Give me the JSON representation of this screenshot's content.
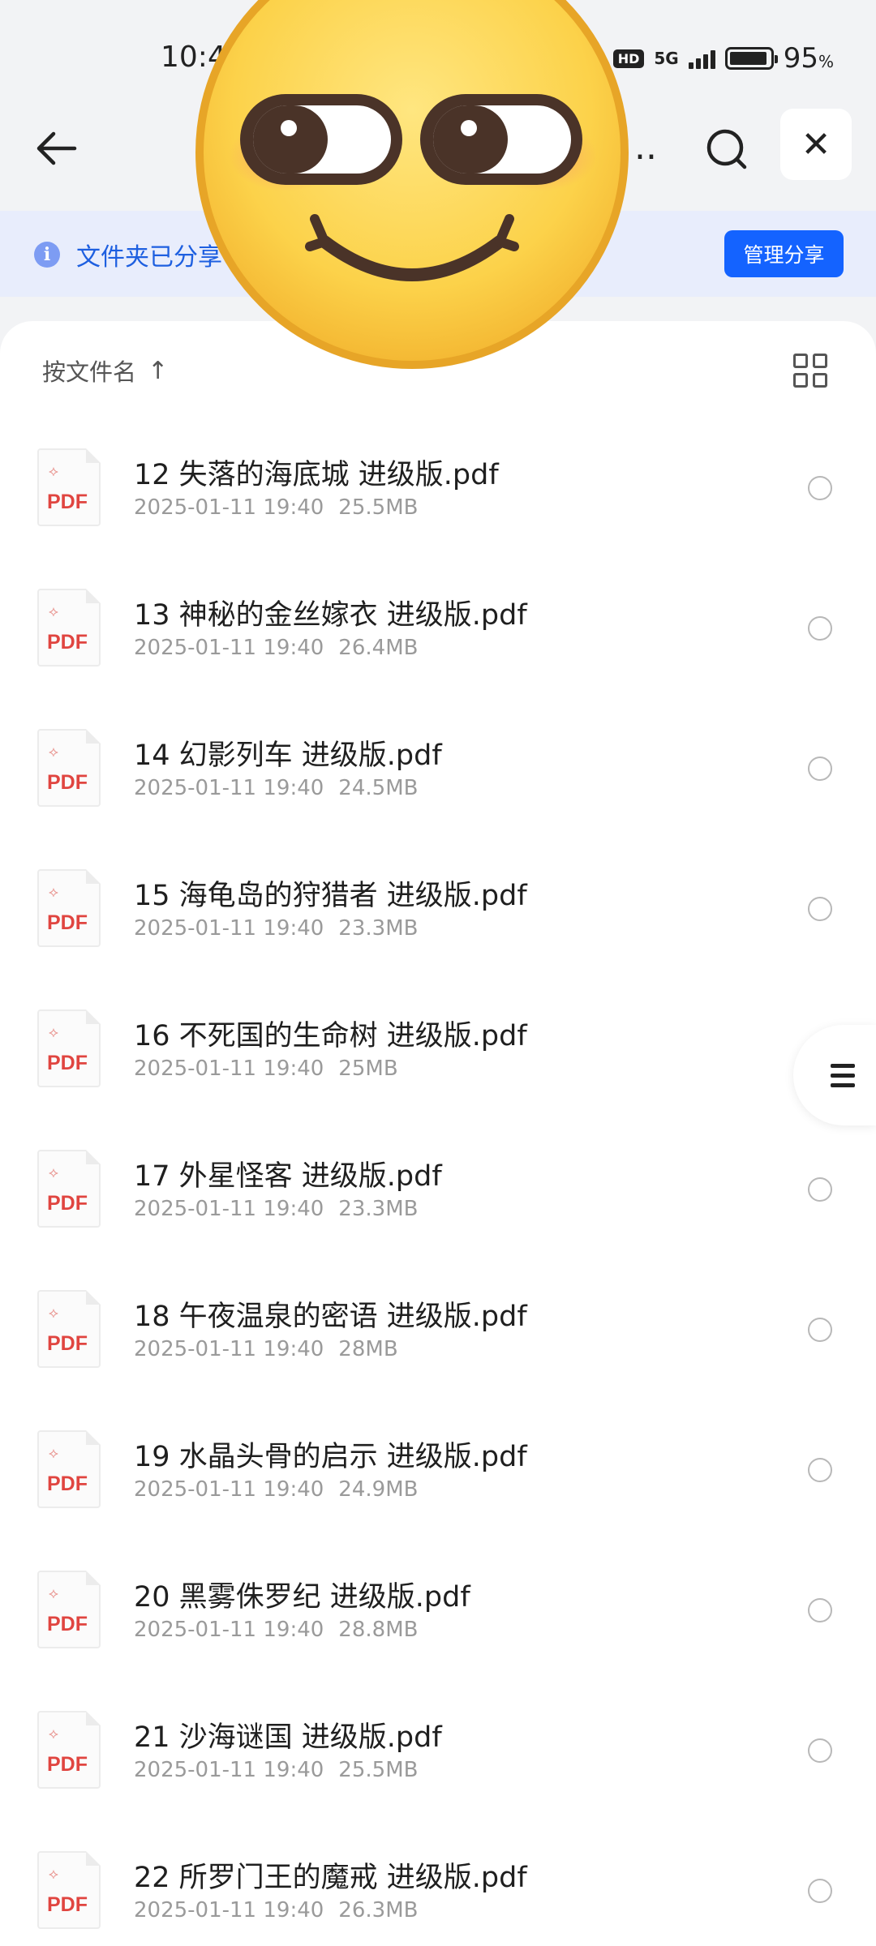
{
  "status_bar": {
    "time": "10:4",
    "battery_text": "95",
    "battery_pct": "%",
    "net_type": "5G",
    "hd_badge": "HD"
  },
  "header": {
    "title": "..",
    "back_icon": "arrow-left-icon",
    "search_icon": "search-icon",
    "close_icon": "close-icon",
    "close_glyph": "✕"
  },
  "share_banner": {
    "info_glyph": "i",
    "text": "文件夹已分享",
    "button_label": "管理分享"
  },
  "toolbar": {
    "sort_label": "按文件名",
    "sort_arrow": "↑",
    "view_icon": "grid-view-icon"
  },
  "files": [
    {
      "name": "12 失落的海底城 进级版.pdf",
      "date": "2025-01-11 19:40",
      "size": "25.5MB",
      "type": "PDF"
    },
    {
      "name": "13 神秘的金丝嫁衣 进级版.pdf",
      "date": "2025-01-11 19:40",
      "size": "26.4MB",
      "type": "PDF"
    },
    {
      "name": "14 幻影列车 进级版.pdf",
      "date": "2025-01-11 19:40",
      "size": "24.5MB",
      "type": "PDF"
    },
    {
      "name": "15 海龟岛的狩猎者 进级版.pdf",
      "date": "2025-01-11 19:40",
      "size": "23.3MB",
      "type": "PDF"
    },
    {
      "name": "16 不死国的生命树 进级版.pdf",
      "date": "2025-01-11 19:40",
      "size": "25MB",
      "type": "PDF"
    },
    {
      "name": "17 外星怪客 进级版.pdf",
      "date": "2025-01-11 19:40",
      "size": "23.3MB",
      "type": "PDF"
    },
    {
      "name": "18 午夜温泉的密语 进级版.pdf",
      "date": "2025-01-11 19:40",
      "size": "28MB",
      "type": "PDF"
    },
    {
      "name": "19 水晶头骨的启示 进级版.pdf",
      "date": "2025-01-11 19:40",
      "size": "24.9MB",
      "type": "PDF"
    },
    {
      "name": "20 黑雾侏罗纪 进级版.pdf",
      "date": "2025-01-11 19:40",
      "size": "28.8MB",
      "type": "PDF"
    },
    {
      "name": "21 沙海谜国 进级版.pdf",
      "date": "2025-01-11 19:40",
      "size": "25.5MB",
      "type": "PDF"
    },
    {
      "name": "22 所罗门王的魔戒 进级版.pdf",
      "date": "2025-01-11 19:40",
      "size": "26.3MB",
      "type": "PDF"
    }
  ],
  "side_tab": {
    "icon": "menu-lines-icon"
  },
  "overlay": {
    "icon": "smirk-emoji-sticker"
  },
  "colors": {
    "accent": "#1463ff",
    "banner_bg": "#e8edfc",
    "pdf_red": "#e04540",
    "page_bg": "#f2f3f5"
  }
}
